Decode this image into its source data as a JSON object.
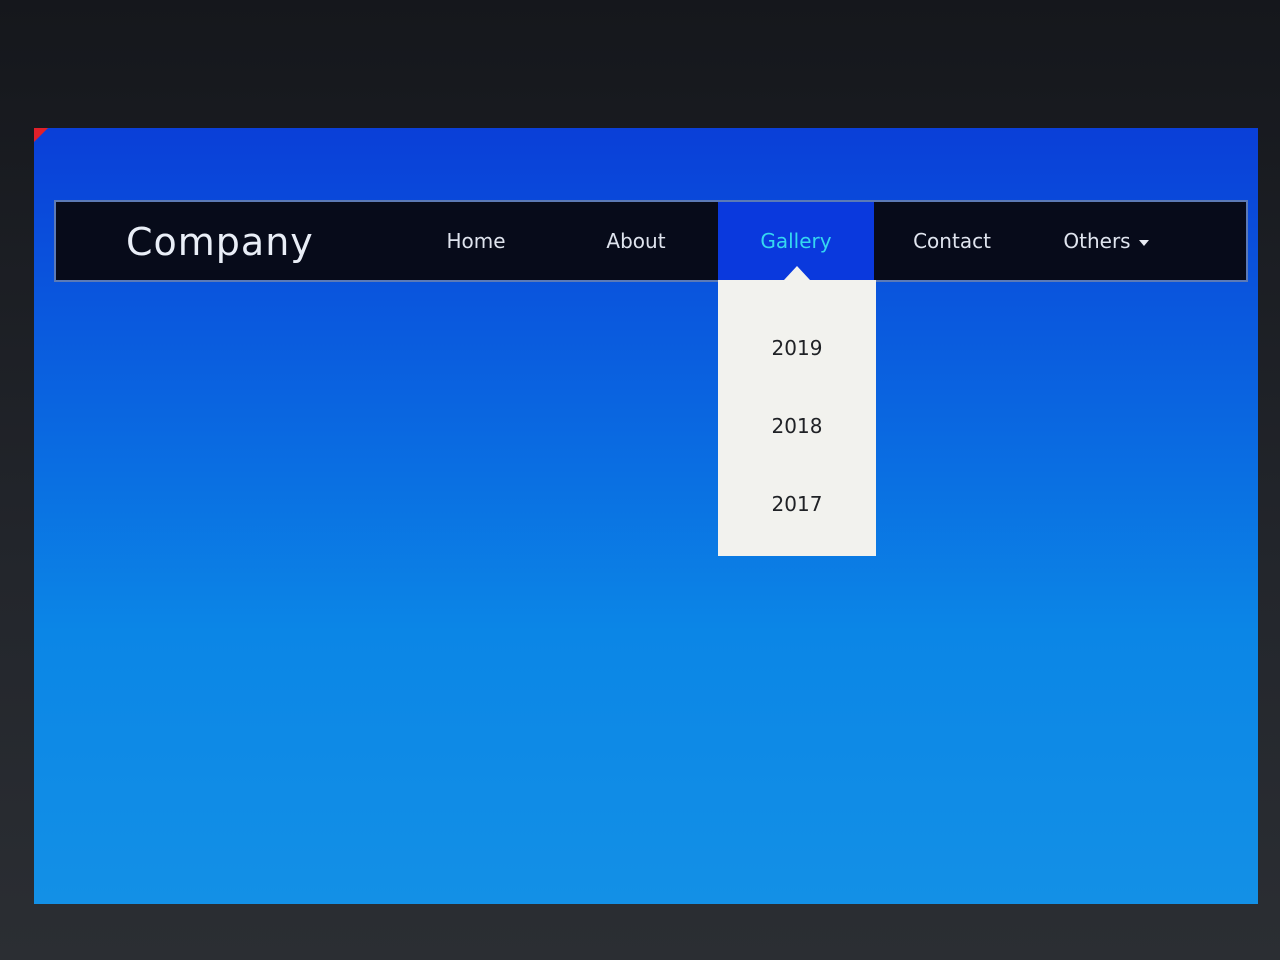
{
  "navbar": {
    "brand": "Company",
    "items": [
      {
        "label": "Home"
      },
      {
        "label": "About"
      },
      {
        "label": "Gallery",
        "active": true
      },
      {
        "label": "Contact"
      },
      {
        "label": "Others",
        "icon": "caret-down-icon"
      }
    ]
  },
  "gallery_dropdown": {
    "items": [
      {
        "label": "2019"
      },
      {
        "label": "2018"
      },
      {
        "label": "2017"
      }
    ]
  },
  "colors": {
    "navbar_bg": "#070b1a",
    "active_tab_bg": "#0a39dd",
    "active_tab_text": "#35d7f0",
    "page_bg_top": "#0a3fd8",
    "page_bg_bottom": "#1390e6",
    "dropdown_bg": "#f2f2ee"
  }
}
